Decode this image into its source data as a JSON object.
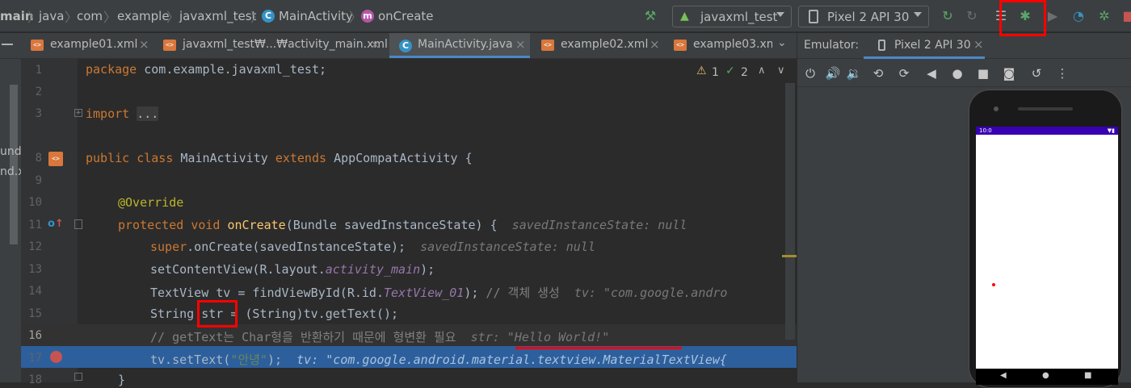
{
  "breadcrumb": [
    "main",
    "java",
    "com",
    "example",
    "javaxml_test",
    "MainActivity",
    "onCreate"
  ],
  "toolbar": {
    "run_config": "javaxml_test",
    "device": "Pixel 2 API 30"
  },
  "tabs": [
    {
      "label": "example01.xml"
    },
    {
      "label": "javaxml_test₩...₩activity_main.xml"
    },
    {
      "label": "MainActivity.java"
    },
    {
      "label": "example02.xml"
    },
    {
      "label": "example03.xm"
    }
  ],
  "left_panel": {
    "item1": "und.",
    "item2": "nd.x"
  },
  "editor": {
    "inspections": {
      "warnings": "1",
      "typos": "2"
    },
    "line_numbers": [
      "1",
      "2",
      "3",
      "8",
      "9",
      "10",
      "11",
      "12",
      "13",
      "14",
      "15",
      "16",
      "17",
      "18"
    ],
    "l1": {
      "kw": "package",
      "rest": " com.example.javaxml_test;"
    },
    "l3": {
      "kw": "import",
      "fold": "..."
    },
    "l8": {
      "kw1": "public",
      "kw2": "class",
      "name": "MainActivity",
      "kw3": "extends",
      "rest": "AppCompatActivity {"
    },
    "l10": {
      "ann": "@Override"
    },
    "l11": {
      "kw1": "protected",
      "kw2": "void",
      "fn": "onCreate",
      "rest": "(Bundle savedInstanceState) {",
      "hint": "savedInstanceState: null"
    },
    "l12": {
      "kw": "super",
      "rest": ".onCreate(savedInstanceState);",
      "hint": "savedInstanceState: null"
    },
    "l13": {
      "pre": "setContentView(R.layout.",
      "it": "activity_main",
      "post": ");"
    },
    "l14": {
      "pre": "TextView tv = findViewById(R.id.",
      "it": "TextView_01",
      "post": ");",
      "cm": "// 객체 생성",
      "hint": "tv: \"com.google.andro"
    },
    "l15": {
      "pre": "String ",
      "var": "str",
      "post": " = (String)tv.getText();"
    },
    "l16": {
      "cm": "// getText는 Char형을 반환하기 때문에 형변환 필요",
      "hint": "str: \"Hello World!\""
    },
    "l17": {
      "pre": "tv.setText(",
      "str": "\"안녕\"",
      "post": ");",
      "hint": "tv: \"com.google.android.material.textview.MaterialTextView{"
    },
    "l18": {
      "rest": "}"
    }
  },
  "emulator": {
    "label": "Emulator:",
    "device_tab": "Pixel 2 API 30",
    "status_time": "10:0"
  },
  "colors": {
    "annotation": "#ff0000",
    "selection": "#2d5f9c",
    "accent": "#4a88c7"
  }
}
